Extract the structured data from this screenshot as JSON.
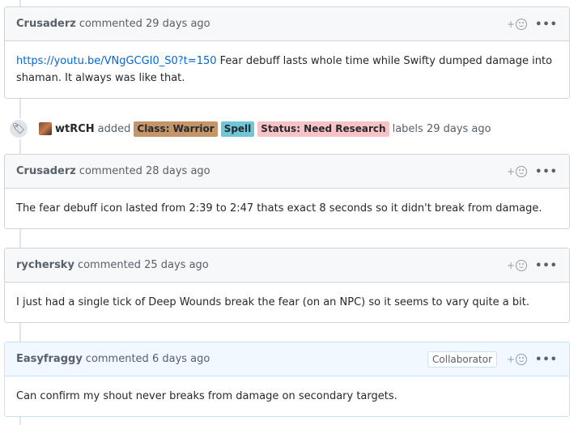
{
  "comments": [
    {
      "author": "Crusaderz",
      "meta": "commented 29 days ago",
      "link": "https://youtu.be/VNgGCGI0_S0?t=150",
      "body": " Fear debuff lasts whole time while Swifty dumped damage into shaman. It always was like that."
    },
    {
      "author": "Crusaderz",
      "meta": "commented 28 days ago",
      "body": "The fear debuff icon lasted from 2:39 to 2:47 thats exact 8 seconds so it didn't break from damage."
    },
    {
      "author": "rychersky",
      "meta": "commented 25 days ago",
      "body": "I just had a single tick of Deep Wounds break the fear (on an NPC) so it seems to vary quite a bit."
    },
    {
      "author": "Easyfraggy",
      "meta": "commented 6 days ago",
      "badge": "Collaborator",
      "body": "Can confirm my shout never breaks from damage on secondary targets."
    }
  ],
  "event": {
    "author": "wtRCH",
    "action": "added",
    "labels": [
      "Class: Warrior",
      "Spell",
      "Status: Need Research"
    ],
    "suffix": "labels 29 days ago"
  },
  "ui": {
    "reaction_plus": "+",
    "more_dots": "•••",
    "tag_glyph": "🏷"
  },
  "colors": {
    "label_warrior": "#c5956a",
    "label_spell": "#6ec6d8",
    "label_status": "#f8c3c6",
    "link": "#0366d6"
  }
}
